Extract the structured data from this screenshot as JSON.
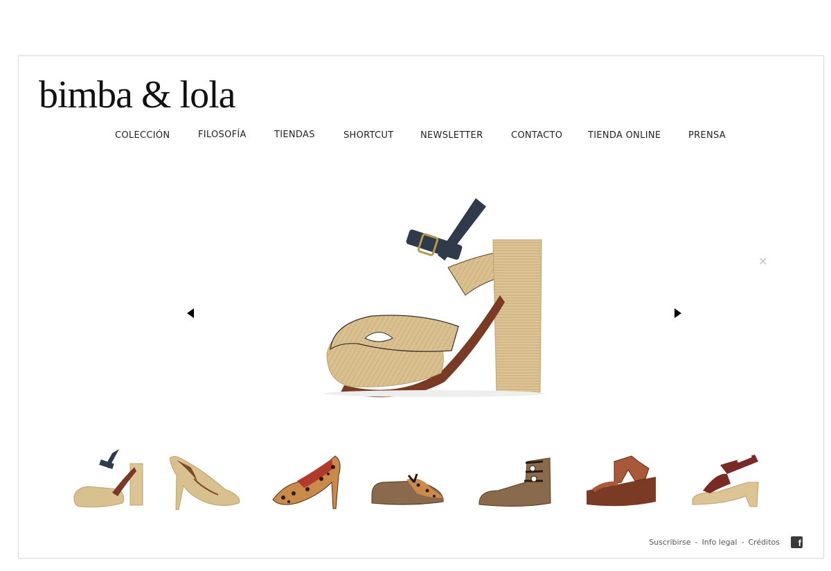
{
  "brand": {
    "logo_text": "bimba & lola"
  },
  "nav": {
    "items": [
      {
        "label": "COLECCIÓN"
      },
      {
        "label": "FILOSOFÍA"
      },
      {
        "label": "TIENDAS"
      },
      {
        "label": "SHORTCUT"
      },
      {
        "label": "NEWSLETTER"
      },
      {
        "label": "CONTACTO"
      },
      {
        "label": "TIENDA ONLINE"
      },
      {
        "label": "PRENSA"
      }
    ]
  },
  "gallery": {
    "close_label": "×",
    "selected_index": 0,
    "thumbnails": [
      {
        "name": "beige-platform-sandal"
      },
      {
        "name": "beige-pump"
      },
      {
        "name": "leopard-pump"
      },
      {
        "name": "leopard-oxford"
      },
      {
        "name": "lace-up-flat"
      },
      {
        "name": "brown-wedge-sandal"
      },
      {
        "name": "espadrille-platform-sandal"
      }
    ]
  },
  "footer": {
    "links": [
      "Suscribirse",
      "Info legal",
      "Créditos"
    ],
    "separator": "-",
    "facebook_glyph": "f"
  },
  "colors": {
    "raffia": "#d8bf8c",
    "strap": "#2f3a4a",
    "leather_brown": "#7a3a24",
    "suede": "#8a6a4c"
  }
}
